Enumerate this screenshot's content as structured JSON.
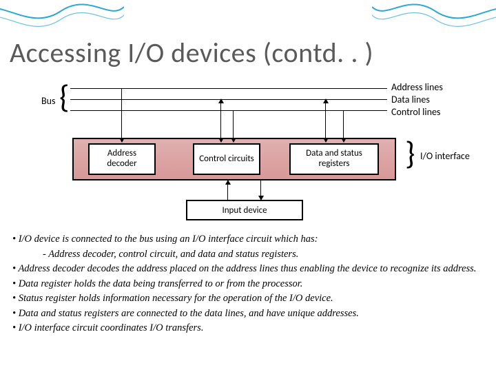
{
  "title": "Accessing I/O devices (contd. . )",
  "labels": {
    "bus": "Bus",
    "address_lines": "Address lines",
    "data_lines": "Data lines",
    "control_lines": "Control lines",
    "io_interface": "I/O interface",
    "input_device": "Input device"
  },
  "components": {
    "address_decoder": "Address decoder",
    "control_circuits": "Control circuits",
    "data_status_registers": "Data and status registers"
  },
  "bullets": {
    "b1": "• I/O device is connected to the bus using an I/O interface circuit which has:",
    "b1sub": "- Address decoder, control circuit, and data and status registers.",
    "b2": "• Address decoder decodes the address placed on the address lines thus enabling the device to recognize its address.",
    "b3": "• Data register holds the data being transferred to or from the processor.",
    "b4": "• Status register holds information necessary for the operation of the I/O device.",
    "b5": "• Data and status registers are connected to the data lines, and have unique addresses.",
    "b6": "• I/O interface circuit coordinates I/O transfers."
  },
  "colors": {
    "wave": "#2aa8d8",
    "io_box_fill": "#d89898"
  }
}
